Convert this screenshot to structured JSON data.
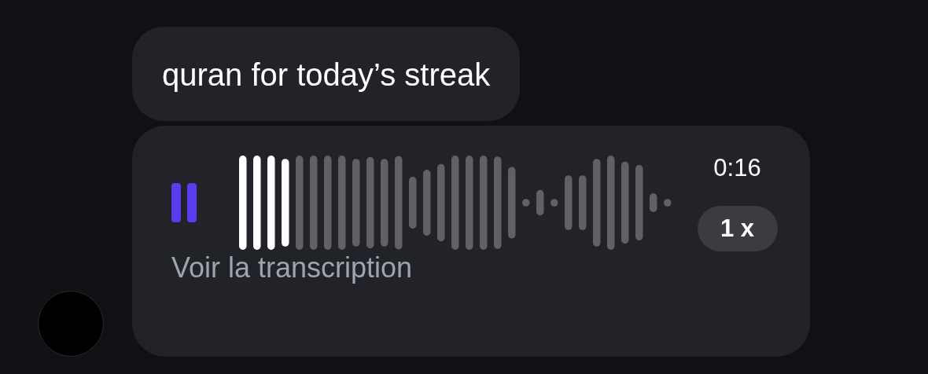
{
  "messages": [
    {
      "kind": "text",
      "text": "quran for today’s streak"
    },
    {
      "kind": "voice",
      "playing": true,
      "level": 0.125,
      "duration": "0:16",
      "speed": "1 x",
      "transcript_link": "Voir la transcription"
    }
  ]
}
